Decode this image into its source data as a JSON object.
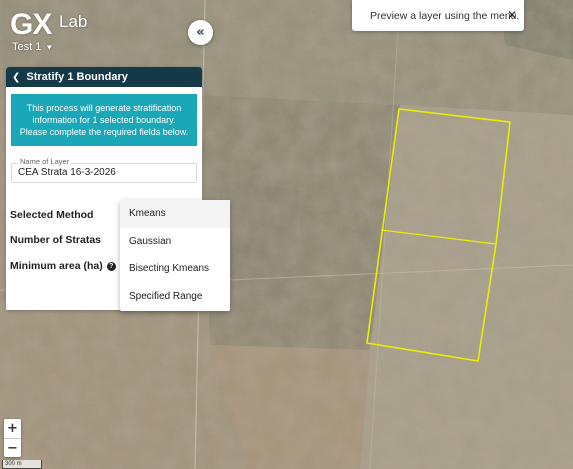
{
  "brand": {
    "logo": "GX",
    "logo_suffix": "Lab",
    "workspace": "Test 1"
  },
  "toast": {
    "message": "Preview a layer using the menu.",
    "close_icon": "close-icon"
  },
  "panel": {
    "title": "Stratify 1 Boundary",
    "info": "This process will generate stratification information for 1 selected boundary. Please complete the required fields below.",
    "layer_name": {
      "label": "Name of Layer",
      "value": "CEA Strata 16-3-2026"
    },
    "selected_method_label": "Selected Method",
    "number_of_stratas_label": "Number of Stratas",
    "minimum_area_label": "Minimum area (ha)"
  },
  "method_dropdown": {
    "options": [
      "Kmeans",
      "Gaussian",
      "Bisecting Kmeans",
      "Specified Range"
    ],
    "selected": "Kmeans"
  },
  "zoom": {
    "in": "+",
    "out": "−"
  },
  "scale_label": "300 m",
  "colors": {
    "header": "#16394a",
    "info": "#1aa7b7",
    "boundary": "#e8f000"
  }
}
